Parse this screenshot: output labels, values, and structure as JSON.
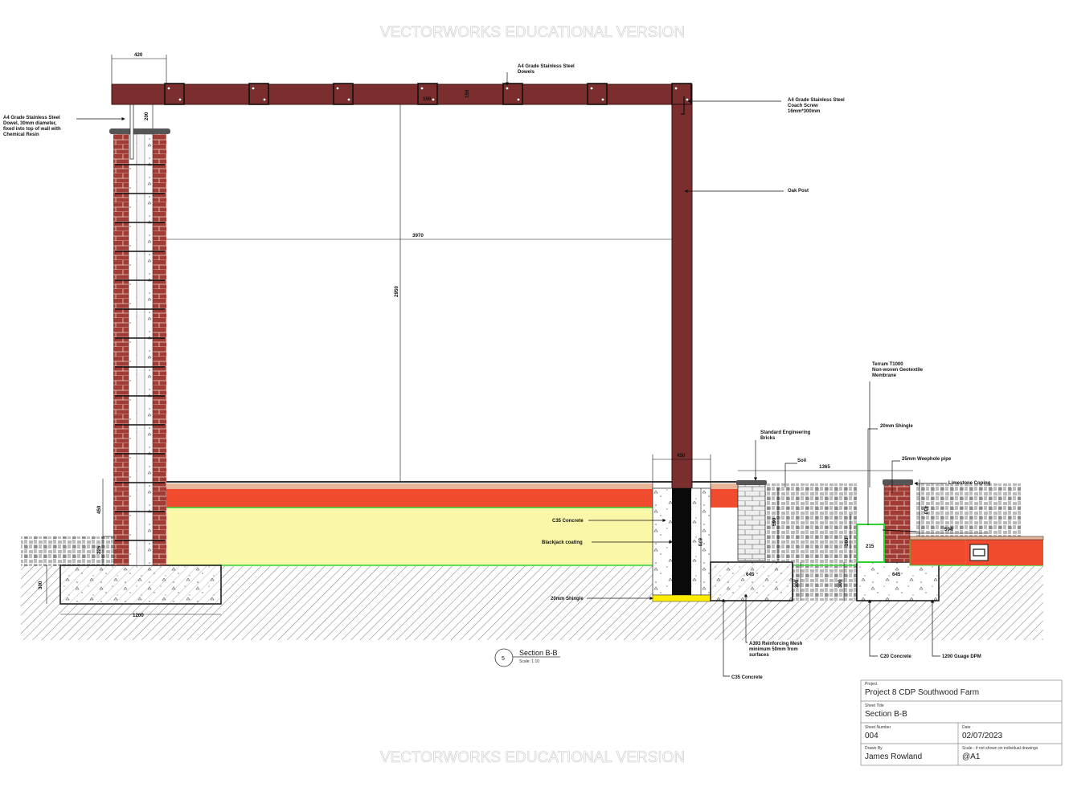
{
  "watermark": "VECTORWORKS EDUCATIONAL VERSION",
  "labels": {
    "dowels": [
      "A4 Grade Stainless Steel",
      "Dowels"
    ],
    "coach_screw": [
      "A4 Grade Stainless Steel",
      "Coach Screw",
      "16mm*300mm"
    ],
    "wall_dowel": [
      "A4 Grade Stainless Steel",
      "Dowel, 30mm diameter,",
      "fixed into top of wall with",
      "Chemical Resin"
    ],
    "oak_post": "Oak Post",
    "geotextile": [
      "Terram T1000",
      "Non-woven Geotextile",
      "Membrane"
    ],
    "shingle_top": "20mm Shingle",
    "eng_bricks": [
      "Standard Engineering",
      "Bricks"
    ],
    "soil": "Soil",
    "weephole": "25mm Weephole pipe",
    "limestone": "Limestone Coping",
    "c35_left": "C35 Concrete",
    "blackjack": "Blackjack coating",
    "shingle_bottom": "20mm Shingle",
    "mesh": [
      "A393 Reinforcing Mesh",
      "minimum 50mm from",
      "surfaces"
    ],
    "c35_bottom": "C35 Concrete",
    "c20": "C20 Concrete",
    "dpm": "1200 Guage DPM"
  },
  "dimensions": {
    "d420": "420",
    "d150a": "150",
    "d150b": "150",
    "d200": "200",
    "d3970": "3970",
    "d2950": "2950",
    "d450_top": "450",
    "d450_side": "450",
    "d225": "225",
    "d300": "300",
    "d1200": "1200",
    "d1365": "1365",
    "d410": "410",
    "d594": "594",
    "d215": "215",
    "d645a": "645",
    "d645b": "645",
    "d670": "670",
    "d590": "590",
    "d300b": "300",
    "d300c": "300",
    "d360": "360"
  },
  "section": {
    "number": "5",
    "title": "Section B-B",
    "scale": "Scale: 1:10"
  },
  "title_block": {
    "project_caption": "Project",
    "project": "Project 8 CDP Southwood Farm",
    "sheet_title_caption": "Sheet Title",
    "sheet_title": "Section B-B",
    "sheet_number_caption": "Sheet Number",
    "sheet_number": "004",
    "date_caption": "Date",
    "date": "02/07/2023",
    "drawn_by_caption": "Drawn By",
    "drawn_by": "James Rowland",
    "scale_caption": "Scale - if not shown on individual drawings",
    "scale": "@A1"
  },
  "colors": {
    "oak": "#7a2e2e",
    "brick": "#9a3a32",
    "red_layer": "#f04a2f",
    "yellow_layer": "#fbf7a8",
    "green_line": "#2fd02f"
  }
}
